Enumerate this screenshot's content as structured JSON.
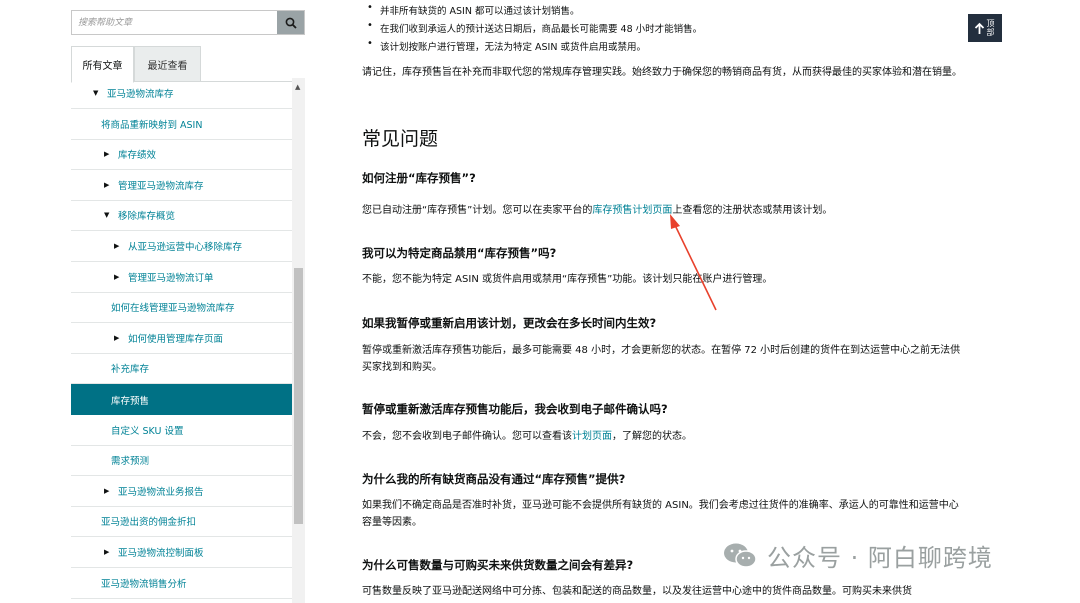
{
  "search": {
    "placeholder": "搜索帮助文章"
  },
  "tabs": {
    "all": "所有文章",
    "recent": "最近查看"
  },
  "nav": [
    {
      "label": "亚马逊物流库存",
      "marker": "▼"
    },
    {
      "label": "将商品重新映射到 ASIN",
      "marker": ""
    },
    {
      "label": "库存绩效",
      "marker": "▶"
    },
    {
      "label": "管理亚马逊物流库存",
      "marker": "▶"
    },
    {
      "label": "移除库存概览",
      "marker": "▼"
    },
    {
      "label": "从亚马逊运营中心移除库存",
      "marker": "▶"
    },
    {
      "label": "管理亚马逊物流订单",
      "marker": "▶"
    },
    {
      "label": "如何在线管理亚马逊物流库存",
      "marker": ""
    },
    {
      "label": "如何使用管理库存页面",
      "marker": "▶"
    },
    {
      "label": "补充库存",
      "marker": ""
    },
    {
      "label": "库存预售",
      "marker": "",
      "selected": true
    },
    {
      "label": "自定义 SKU 设置",
      "marker": ""
    },
    {
      "label": "需求预测",
      "marker": ""
    },
    {
      "label": "亚马逊物流业务报告",
      "marker": "▶"
    },
    {
      "label": "亚马逊出资的佣金折扣",
      "marker": ""
    },
    {
      "label": "亚马逊物流控制面板",
      "marker": "▶"
    },
    {
      "label": "亚马逊物流销售分析",
      "marker": ""
    }
  ],
  "content": {
    "bullets": [
      "并非所有缺货的 ASIN 都可以通过该计划销售。",
      "在我们收到承运人的预计送达日期后，商品最长可能需要 48 小时才能销售。",
      "该计划按账户进行管理，无法为特定 ASIN 或货件启用或禁用。"
    ],
    "note": "请记住，库存预售旨在补充而非取代您的常规库存管理实践。始终致力于确保您的畅销商品有货，从而获得最佳的买家体验和潜在销量。",
    "faq_title": "常见问题",
    "q1": "如何注册“库存预售”?",
    "a1_pre": "您已自动注册“库存预售”计划。您可以在卖家平台的",
    "a1_link": "库存预售计划页面",
    "a1_post": "上查看您的注册状态或禁用该计划。",
    "q2": "我可以为特定商品禁用“库存预售”吗?",
    "a2": "不能，您不能为特定 ASIN 或货件启用或禁用“库存预售”功能。该计划只能在账户进行管理。",
    "q3": "如果我暂停或重新启用该计划，更改会在多长时间内生效?",
    "a3": "暂停或重新激活库存预售功能后，最多可能需要 48 小时，才会更新您的状态。在暂停 72 小时后创建的货件在到达运营中心之前无法供买家找到和购买。",
    "q4": "暂停或重新激活库存预售功能后，我会收到电子邮件确认吗?",
    "a4_pre": "不会，您不会收到电子邮件确认。您可以查看该",
    "a4_link": "计划页面",
    "a4_post": "，了解您的状态。",
    "q5": "为什么我的所有缺货商品没有通过“库存预售”提供?",
    "a5": "如果我们不确定商品是否准时补货，亚马逊可能不会提供所有缺货的 ASIN。我们会考虑过往货件的准确率、承运人的可靠性和运营中心容量等因素。",
    "q6": "为什么可售数量与可购买未来供货数量之间会有差异?",
    "a6": "可售数量反映了亚马逊配送网络中可分拣、包装和配送的商品数量，以及发往运营中心途中的货件商品数量。可购买未来供货"
  },
  "top_button": {
    "label": "顶部"
  },
  "watermark": {
    "text": "公众号 · 阿白聊跨境"
  },
  "colors": {
    "accent": "#008296",
    "selected_bg": "#007185",
    "arrow": "#e8412c"
  }
}
